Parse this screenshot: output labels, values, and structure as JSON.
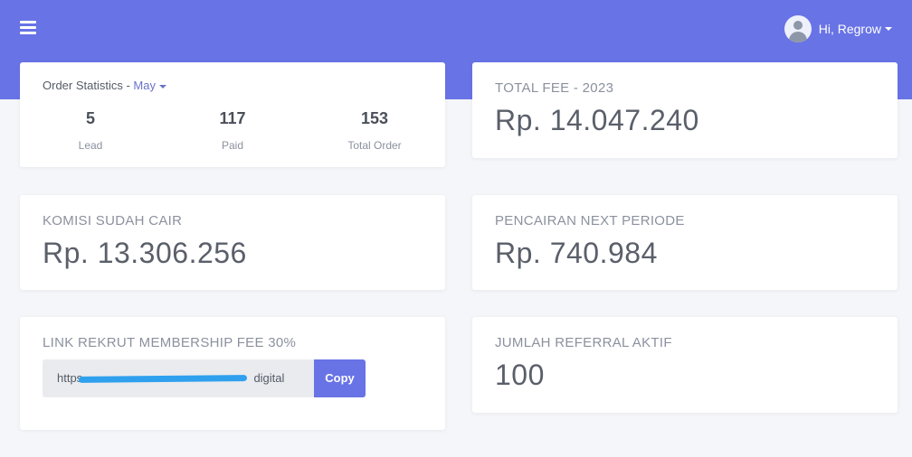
{
  "header": {
    "greeting": "Hi, Regrow"
  },
  "order_stats": {
    "title": "Order Statistics - ",
    "month": "May",
    "items": [
      {
        "value": "5",
        "label": "Lead"
      },
      {
        "value": "117",
        "label": "Paid"
      },
      {
        "value": "153",
        "label": "Total Order"
      }
    ]
  },
  "total_fee": {
    "label": "TOTAL FEE - 2023",
    "value": "Rp. 14.047.240"
  },
  "komisi": {
    "label": "KOMISI SUDAH CAIR",
    "value": "Rp. 13.306.256"
  },
  "pencairan": {
    "label": "PENCAIRAN NEXT PERIODE",
    "value": "Rp. 740.984"
  },
  "link_rekrut": {
    "label": "LINK REKRUT MEMBERSHIP FEE 30%",
    "prefix": "https",
    "suffix": "digital",
    "copy_label": "Copy"
  },
  "referral": {
    "label": "JUMLAH REFERRAL AKTIF",
    "value": "100"
  },
  "colors": {
    "accent": "#6873e6",
    "background": "#f5f6f9",
    "redaction": "#2fa0ee"
  }
}
